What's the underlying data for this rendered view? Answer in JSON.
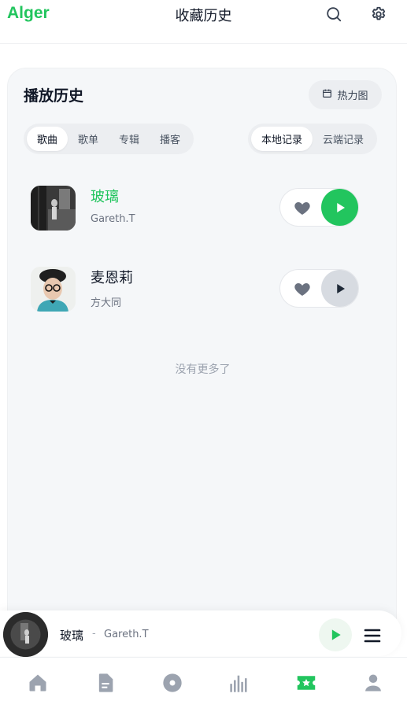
{
  "app": {
    "logo": "Alger",
    "title": "收藏历史"
  },
  "colors": {
    "accent": "#22c55e",
    "card_bg": "#f5f7f9",
    "icon_gray": "#9ca3af"
  },
  "header": {
    "icons": [
      "search-icon",
      "gear-icon"
    ]
  },
  "card": {
    "title": "播放历史",
    "heatmap_label": "热力图",
    "type_tabs": [
      {
        "label": "歌曲",
        "active": true
      },
      {
        "label": "歌单",
        "active": false
      },
      {
        "label": "专辑",
        "active": false
      },
      {
        "label": "播客",
        "active": false
      }
    ],
    "source_tabs": [
      {
        "label": "本地记录",
        "active": true
      },
      {
        "label": "云端记录",
        "active": false
      }
    ],
    "songs": [
      {
        "name": "玻璃",
        "artist": "Gareth.T",
        "playing": true
      },
      {
        "name": "麦恩莉",
        "artist": "方大同",
        "playing": false
      }
    ],
    "end_text": "没有更多了"
  },
  "player": {
    "title": "玻璃",
    "separator": "-",
    "artist": "Gareth.T"
  },
  "nav": [
    "home-icon",
    "document-icon",
    "disc-icon",
    "chart-bars-icon",
    "ticket-star-icon",
    "user-icon"
  ]
}
